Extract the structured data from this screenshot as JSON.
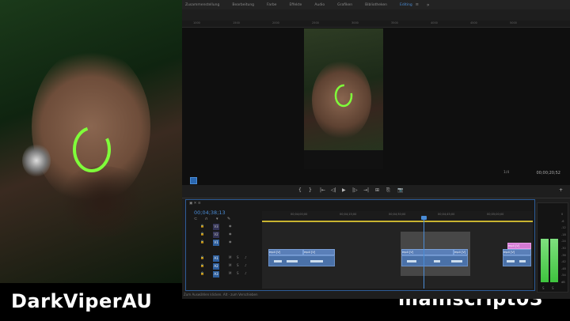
{
  "captions": {
    "left": "DarkViperAU",
    "right": "mainscript03"
  },
  "workspace_tabs": [
    {
      "label": "Zusammenstellung",
      "active": false
    },
    {
      "label": "Bearbeitung",
      "active": false
    },
    {
      "label": "Farbe",
      "active": false
    },
    {
      "label": "Effekte",
      "active": false
    },
    {
      "label": "Audio",
      "active": false
    },
    {
      "label": "Grafiken",
      "active": false
    },
    {
      "label": "Bibliotheken",
      "active": false
    },
    {
      "label": "Editing",
      "active": true
    }
  ],
  "workspace_close": "≡",
  "workspace_more": "»",
  "monitor": {
    "fit_label": "1/4",
    "timecode": "00;00;20;52",
    "ruler_ticks": [
      "1000",
      "1500",
      "2000",
      "2500",
      "3000",
      "3500",
      "4000",
      "4500",
      "5000"
    ]
  },
  "transport": {
    "buttons": [
      "{",
      "}",
      "|←",
      "◁|",
      "▶",
      "|▷",
      "→|",
      "⊞",
      "⎘",
      "📷",
      "+"
    ]
  },
  "timeline": {
    "sequence_name": "▣ ✕ ≡",
    "timecode": "00;04;38;13",
    "ruler_ticks": [
      "00;04;00;00",
      "00;04;15;00",
      "00;04;30;00",
      "00;04;45;00",
      "00;05;00;00"
    ],
    "video_tracks": [
      "V3",
      "V2",
      "V1"
    ],
    "audio_tracks": [
      "A1",
      "A2",
      "A3"
    ],
    "clip_labels": [
      "mp4 [V]",
      "mp4 [V]",
      "mp4 [V]",
      "mp4 [V]",
      "mp4 [V]",
      "mp4 [V]"
    ],
    "pink_clip_label": "mp4 [V]"
  },
  "status_text": "Zum Auswählen klicken. Alt - zum Verschieben",
  "meters": {
    "scale": [
      "0",
      "-6",
      "-12",
      "-18",
      "-24",
      "-30",
      "-36",
      "-42",
      "-48",
      "-54",
      "dB"
    ],
    "left_level": 0.63,
    "right_level": 0.63,
    "bottom_labels": [
      "S",
      "S"
    ]
  },
  "colors": {
    "accent": "#4a8cd6",
    "meter_green": "#3ec43e",
    "caption": "#ffffff"
  }
}
